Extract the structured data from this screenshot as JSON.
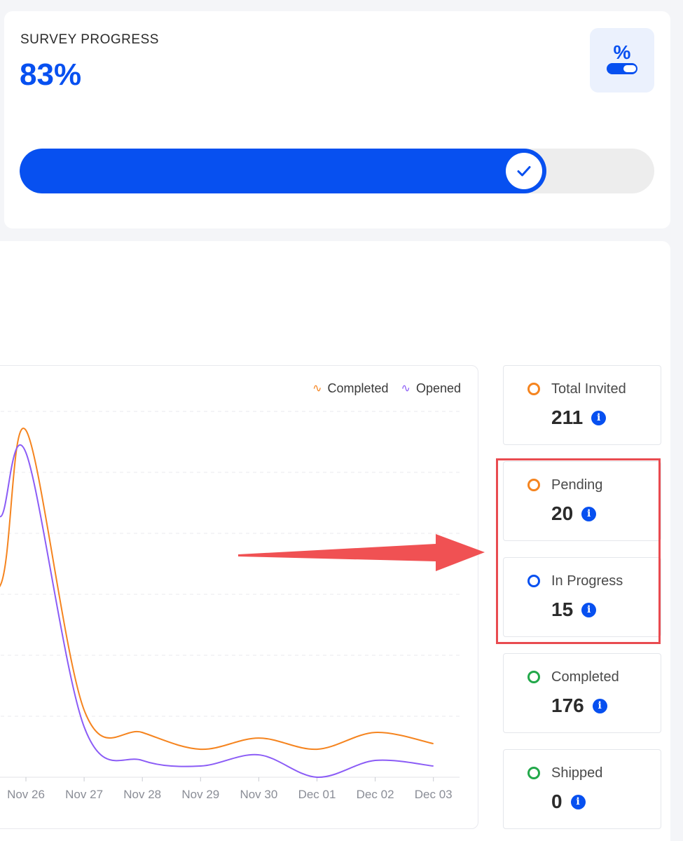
{
  "survey_progress": {
    "title": "SURVEY PROGRESS",
    "value_label": "83%",
    "progress": 0.83,
    "badge_icon": "percent-toggle-icon",
    "checkmark_icon": "check-icon"
  },
  "chart_data": {
    "type": "line",
    "x": [
      "Nov 26",
      "Nov 27",
      "Nov 28",
      "Nov 29",
      "Nov 30",
      "Dec 01",
      "Dec 02",
      "Dec 03"
    ],
    "series": [
      {
        "name": "Completed",
        "color": "#f5841f",
        "values": [
          31,
          6,
          4,
          2.5,
          3.5,
          2.5,
          4,
          3
        ]
      },
      {
        "name": "Opened",
        "color": "#8b5cf6",
        "values": [
          29,
          4.5,
          1.5,
          1,
          2,
          0,
          1.5,
          1
        ]
      }
    ],
    "legend_position": "top-right",
    "grid": true
  },
  "stats": [
    {
      "label": "Total Invited",
      "value": "211",
      "dot_color": "#f5841f"
    },
    {
      "label": "Pending",
      "value": "20",
      "dot_color": "#f5841f"
    },
    {
      "label": "In Progress",
      "value": "15",
      "dot_color": "#0750f0"
    },
    {
      "label": "Completed",
      "value": "176",
      "dot_color": "#22a84a"
    },
    {
      "label": "Shipped",
      "value": "0",
      "dot_color": "#22a84a"
    }
  ],
  "colors": {
    "accent": "#0750f0",
    "highlight": "#e94b50"
  }
}
